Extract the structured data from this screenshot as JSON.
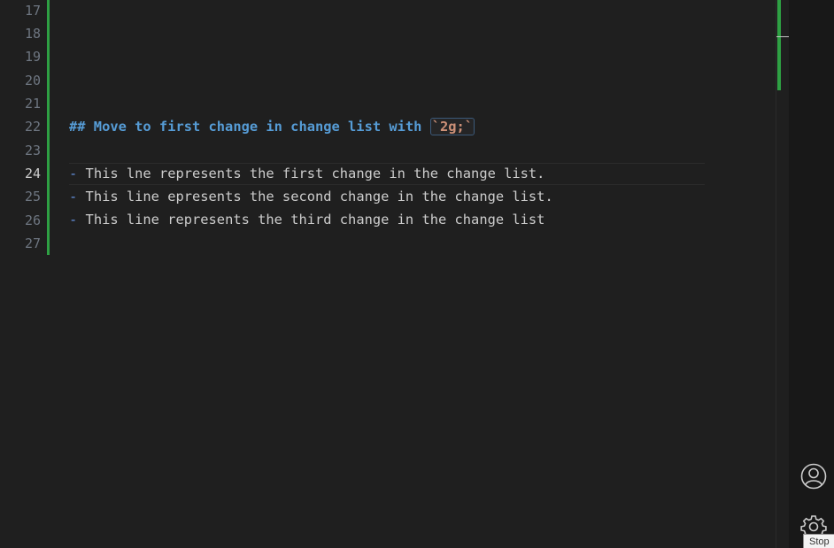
{
  "editor": {
    "line_numbers": [
      "17",
      "18",
      "19",
      "20",
      "21",
      "22",
      "23",
      "24",
      "25",
      "26",
      "27"
    ],
    "active_line": "24",
    "heading": {
      "prefix": "## Move to first change in change list with ",
      "code": "`2g;`"
    },
    "lines": [
      {
        "bullet": "-",
        "text": " This lne represents the first change in the change list."
      },
      {
        "bullet": "-",
        "text": " This line epresents the second change in the change list."
      },
      {
        "bullet": "-",
        "text": " This line represents the third change in the change list"
      }
    ]
  },
  "activity_bar": {
    "account_icon": "account-icon",
    "settings_icon": "gear-icon",
    "tooltip": "Stop"
  },
  "colors": {
    "background": "#1f1f1f",
    "change_marker": "#2ea043",
    "heading": "#569cd6",
    "inline_code": "#ce9178"
  }
}
